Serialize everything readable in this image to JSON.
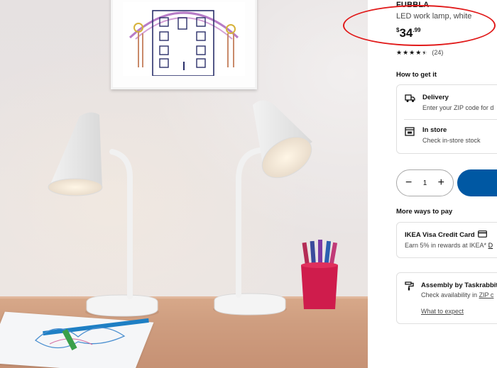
{
  "product": {
    "name": "FUBBLA",
    "description": "LED work lamp, white",
    "price": {
      "currency": "$",
      "main": "34",
      "cents": ".99"
    },
    "rating": {
      "stars": 4.5,
      "count": "(24)"
    }
  },
  "how_to_get": {
    "title": "How to get it",
    "delivery": {
      "title": "Delivery",
      "subtitle": "Enter your ZIP code for d"
    },
    "in_store": {
      "title": "In store",
      "subtitle": "Check in-store stock"
    }
  },
  "quantity": {
    "minus": "−",
    "value": "1",
    "plus": "+"
  },
  "more_ways_to_pay": {
    "title": "More ways to pay",
    "card": {
      "title": "IKEA Visa Credit Card",
      "subtitle": "Earn 5% in rewards at IKEA*",
      "link": "D"
    }
  },
  "assembly": {
    "title": "Assembly by Taskrabbit",
    "subtitle": "Check availability in",
    "link": "ZIP c",
    "what_to_expect": "What to expect"
  },
  "colors": {
    "accent": "#0058a3",
    "annotation": "#e11a1a"
  },
  "icons": [
    "truck-icon",
    "store-icon",
    "credit-card-icon",
    "tools-icon",
    "star-icon"
  ]
}
